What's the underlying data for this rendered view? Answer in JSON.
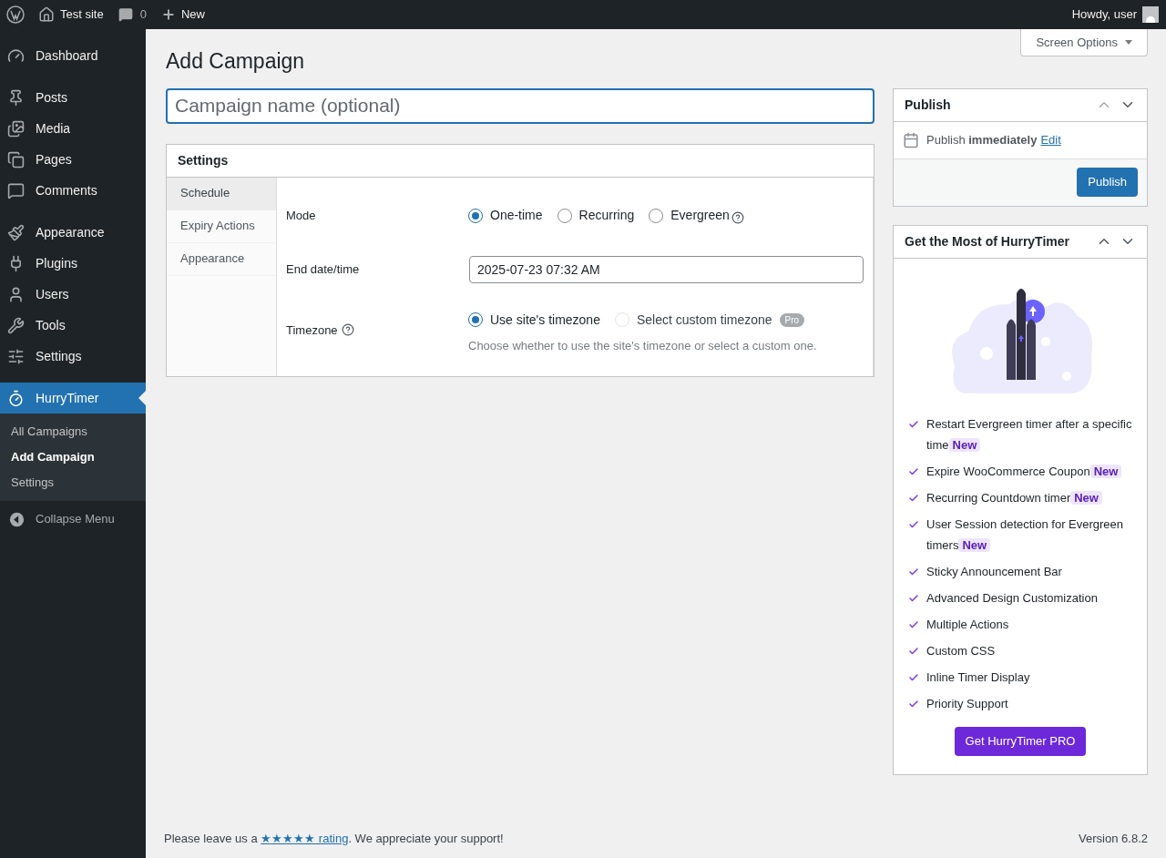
{
  "admin_bar": {
    "site": "Test site",
    "comments": "0",
    "new": "New",
    "greeting": "Howdy, user"
  },
  "sidebar": {
    "groups": [
      {
        "items": [
          {
            "label": "Dashboard",
            "selected": false
          }
        ]
      },
      {
        "items": [
          {
            "label": "Posts",
            "selected": false
          },
          {
            "label": "Media",
            "selected": false
          },
          {
            "label": "Pages",
            "selected": false
          },
          {
            "label": "Comments",
            "selected": false
          }
        ]
      },
      {
        "items": [
          {
            "label": "Appearance",
            "selected": false
          },
          {
            "label": "Plugins",
            "selected": false
          },
          {
            "label": "Users",
            "selected": false
          },
          {
            "label": "Tools",
            "selected": false
          },
          {
            "label": "Settings",
            "selected": false
          }
        ]
      },
      {
        "items": [
          {
            "label": "HurryTimer",
            "selected": true
          }
        ]
      }
    ],
    "submenu": [
      {
        "label": "All Campaigns",
        "selected": false
      },
      {
        "label": "Add Campaign",
        "selected": true
      },
      {
        "label": "Settings",
        "selected": false
      }
    ],
    "collapse": "Collapse Menu"
  },
  "screen_options": "Screen Options",
  "page_title": "Add Campaign",
  "campaign_name": {
    "placeholder": "Campaign name (optional)"
  },
  "settings": {
    "title": "Settings",
    "tabs": [
      {
        "label": "Schedule",
        "selected": true
      },
      {
        "label": "Expiry Actions",
        "selected": false
      },
      {
        "label": "Appearance",
        "selected": false
      }
    ],
    "mode": {
      "label": "Mode",
      "options": [
        {
          "label": "One-time",
          "selected": true,
          "help": false
        },
        {
          "label": "Recurring",
          "selected": false,
          "help": false
        },
        {
          "label": "Evergreen",
          "selected": false,
          "help": true
        }
      ]
    },
    "end_date": {
      "label": "End date/time",
      "value": "2025-07-23 07:32 AM"
    },
    "timezone": {
      "label": "Timezone",
      "options": [
        {
          "label": "Use site's timezone",
          "selected": true,
          "disabled": false
        },
        {
          "label": "Select custom timezone",
          "selected": false,
          "disabled": true,
          "badge": "Pro"
        }
      ],
      "hint": "Choose whether to use the site's timezone or select a custom one."
    }
  },
  "publish": {
    "title": "Publish",
    "status": "Publish **immediately**",
    "edit": "Edit",
    "button": "Publish"
  },
  "promo": {
    "title": "Get the Most of HurryTimer",
    "features": [
      {
        "text": "Restart Evergreen timer after a specific time",
        "badge": "New"
      },
      {
        "text": "Expire WooCommerce Coupon",
        "badge": "New"
      },
      {
        "text": "Recurring Countdown timer",
        "badge": "New"
      },
      {
        "text": "User Session detection for Evergreen timers",
        "badge": "New"
      },
      {
        "text": "Sticky Announcement Bar"
      },
      {
        "text": "Advanced Design Customization"
      },
      {
        "text": "Multiple Actions"
      },
      {
        "text": "Custom CSS"
      },
      {
        "text": "Inline Timer Display"
      },
      {
        "text": "Priority Support"
      }
    ],
    "button": "Get HurryTimer PRO"
  },
  "footer": {
    "before": "Please leave us a ",
    "link": "★★★★★ rating",
    "after": ". We appreciate your support!",
    "version": "Version 6.8.2"
  }
}
